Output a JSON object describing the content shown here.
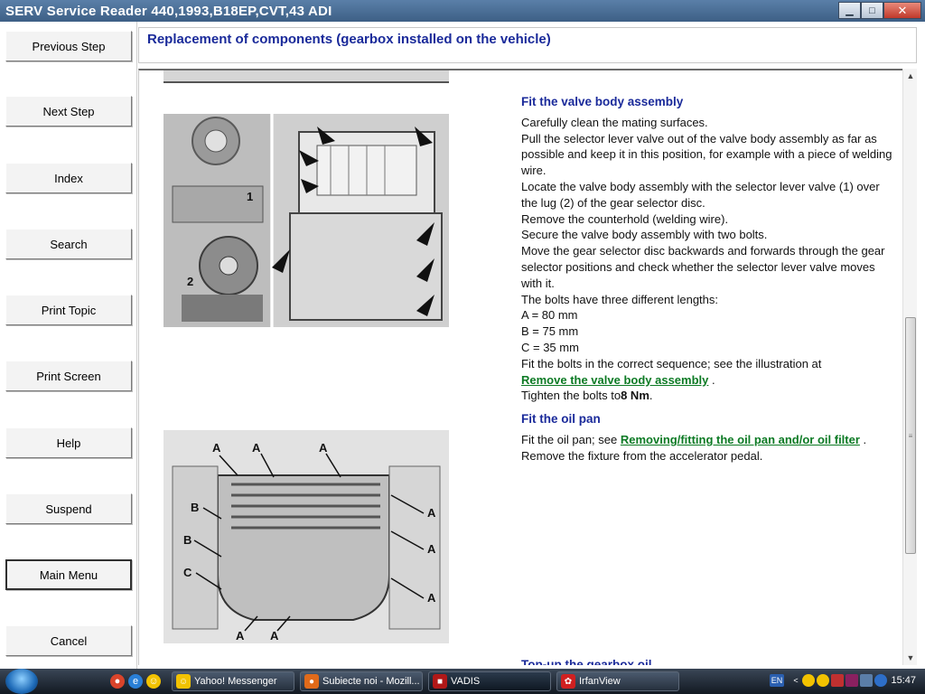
{
  "window": {
    "title": "SERV Service Reader 440,1993,B18EP,CVT,43 ADI",
    "min_glyph": "▁",
    "max_glyph": "□",
    "close_glyph": "✕"
  },
  "sidebar": {
    "buttons": [
      {
        "label": "Previous Step"
      },
      {
        "label": "Next Step"
      },
      {
        "label": "Index"
      },
      {
        "label": "Search"
      },
      {
        "label": "Print Topic"
      },
      {
        "label": "Print Screen"
      },
      {
        "label": "Help"
      },
      {
        "label": "Suspend"
      },
      {
        "label": "Main Menu"
      },
      {
        "label": "Cancel"
      }
    ]
  },
  "page": {
    "title": "Replacement of components (gearbox installed on the vehicle)"
  },
  "sections": {
    "valve": {
      "title": "Fit the valve body assembly",
      "lines": [
        "Carefully clean the mating surfaces.",
        "Pull the selector lever valve out of the valve body assembly as far as possible and keep it in this position, for example with a piece of welding wire.",
        "Locate the valve body assembly with the selector lever valve (1) over the lug (2) of the gear selector disc.",
        "Remove the counterhold (welding wire).",
        "Secure the valve body assembly with two bolts.",
        "Move the gear selector disc backwards and forwards through the gear selector positions and check whether the selector lever valve moves with it.",
        "The bolts have three different lengths:",
        "A = 80 mm",
        "B = 75 mm",
        "C = 35 mm",
        "Fit the bolts in the correct sequence; see the illustration at"
      ],
      "link": "Remove the valve body assembly",
      "link_suffix": ".",
      "torque_prefix": "Tighten the bolts to",
      "torque_value": "8 Nm",
      "torque_suffix": "."
    },
    "oilpan": {
      "title": "Fit the oil pan",
      "prefix": "Fit the oil pan; see",
      "link": "Removing/fitting the oil pan and/or oil filter",
      "link_suffix": ".",
      "line2": "Remove the fixture from the accelerator pedal."
    },
    "next": {
      "title": "Top-up the gearbox oil"
    }
  },
  "figure1": {
    "labels": [
      "1",
      "2"
    ]
  },
  "figure2": {
    "labels": [
      "A",
      "A",
      "A",
      "A",
      "A",
      "A",
      "A",
      "A",
      "B",
      "B",
      "C"
    ]
  },
  "scrollbar": {
    "up_glyph": "▲",
    "down_glyph": "▼",
    "grip_glyph": "≡"
  },
  "taskbar": {
    "quicklaunch": [
      {
        "icon": "chrome-icon",
        "color": "#d9442b",
        "glyph": "●"
      },
      {
        "icon": "ie-icon",
        "color": "#2a7fd6",
        "glyph": "e"
      },
      {
        "icon": "messenger-icon",
        "color": "#f2c200",
        "glyph": "☺"
      }
    ],
    "tasks": [
      {
        "label": "Yahoo! Messenger",
        "icon": "yahoo-messenger-icon",
        "color": "#f2c200",
        "glyph": "☺"
      },
      {
        "label": "Subiecte noi - Mozill...",
        "icon": "firefox-icon",
        "color": "#e06a1a",
        "glyph": "●"
      },
      {
        "label": "VADIS",
        "icon": "vadis-icon",
        "color": "#b01818",
        "glyph": "■"
      },
      {
        "label": "IrfanView",
        "icon": "irfanview-icon",
        "color": "#d02020",
        "glyph": "✿"
      }
    ],
    "tray": {
      "lang": "EN",
      "time": "15:47"
    }
  },
  "colors": {
    "heading": "#1a2a9a",
    "link": "#0c7a24"
  }
}
